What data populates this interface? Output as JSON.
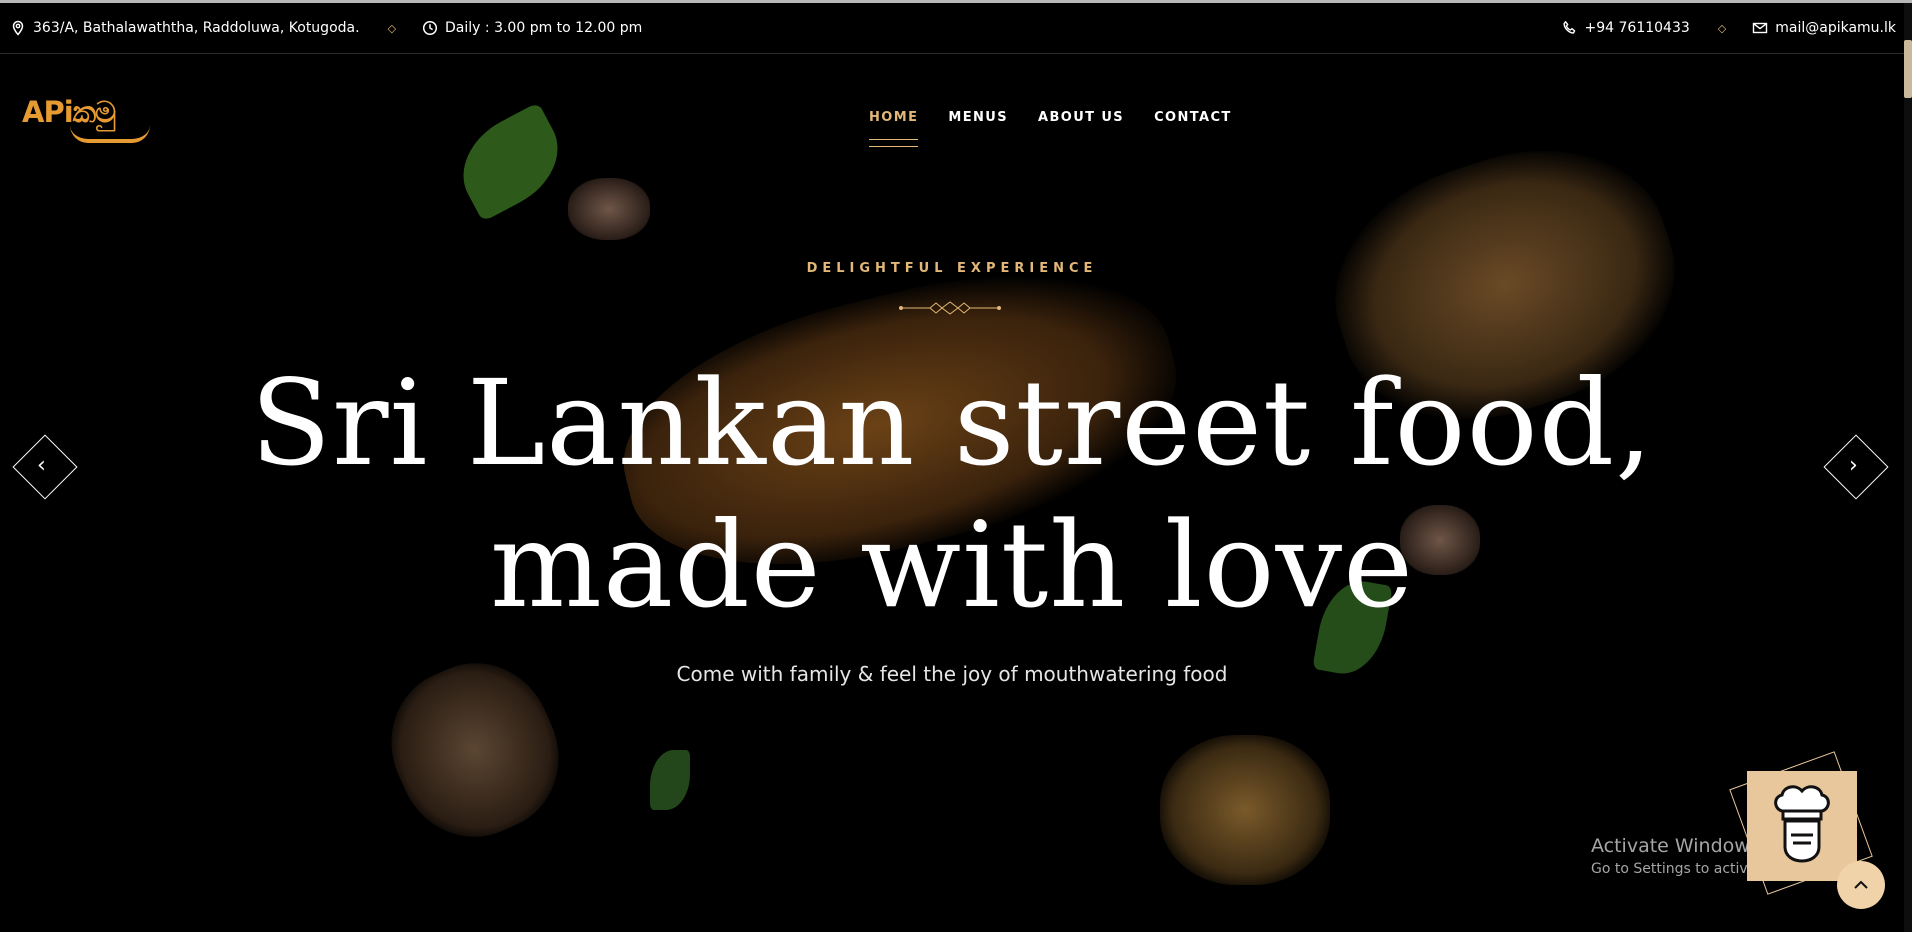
{
  "topbar": {
    "address": "363/A, Bathalawaththa, Raddoluwa, Kotugoda.",
    "hours": "Daily : 3.00 pm to 12.00 pm",
    "phone": "+94 76110433",
    "email": "mail@apikamu.lk"
  },
  "logo": {
    "text": "APiකමු"
  },
  "nav": {
    "items": [
      "HOME",
      "MENUS",
      "ABOUT US",
      "CONTACT"
    ],
    "active": "HOME"
  },
  "hero": {
    "eyebrow": "DELIGHTFUL EXPERIENCE",
    "headline_line1": "Sri Lankan street food,",
    "headline_line2": "made with love",
    "subheadline": "Come with family & feel the joy of mouthwatering food"
  },
  "slider": {
    "prev_icon": "chevron-left-icon",
    "next_icon": "chevron-right-icon"
  },
  "watermark": {
    "title": "Activate Windows",
    "subtitle": "Go to Settings to activate Windows."
  },
  "colors": {
    "accent": "#e2b777",
    "logo": "#e59a32",
    "background": "#000000",
    "badge": "#e8c79c"
  }
}
